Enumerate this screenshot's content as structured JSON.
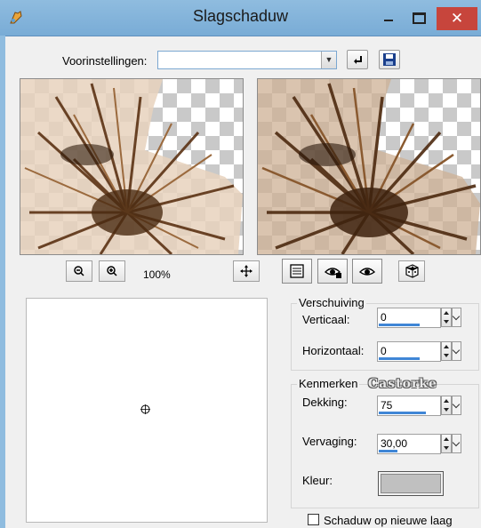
{
  "window": {
    "title": "Slagschaduw"
  },
  "title_buttons": {
    "close": "✕"
  },
  "presets": {
    "label": "Voorinstellingen:",
    "value": ""
  },
  "zoom": {
    "level": "100%"
  },
  "offset": {
    "group_title": "Verschuiving",
    "vertical": {
      "label": "Verticaal:",
      "value": "0"
    },
    "horizontal": {
      "label": "Horizontaal:",
      "value": "0"
    }
  },
  "attributes": {
    "group_title": "Kenmerken",
    "watermark": "Castorke",
    "opacity": {
      "label": "Dekking:",
      "value": "75",
      "level": 0.75
    },
    "blur": {
      "label": "Vervaging:",
      "value": "30,00",
      "level": 0.3
    },
    "color": {
      "label": "Kleur:",
      "value": "#c0c0c0"
    }
  },
  "new_layer": {
    "label": "Schaduw op nieuwe laag",
    "checked": false
  },
  "colors": {
    "accent": "#3f86d6",
    "title_bar": "#8fbcdf",
    "close_button": "#c7453c"
  }
}
